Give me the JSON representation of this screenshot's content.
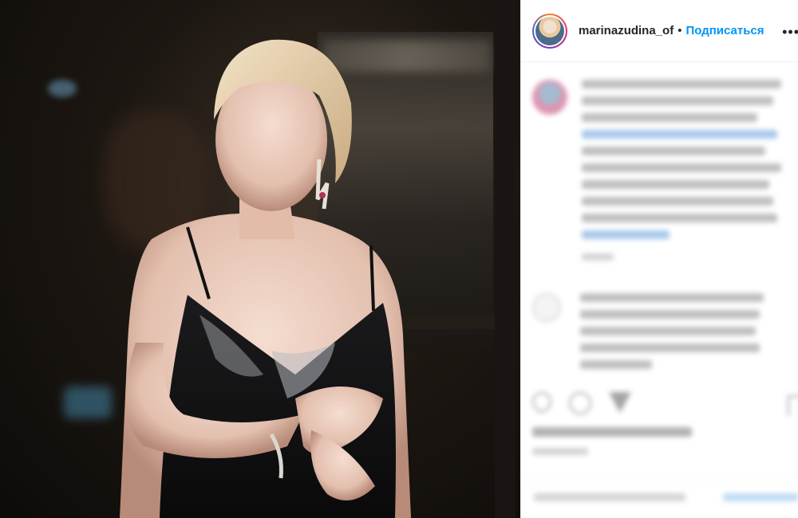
{
  "header": {
    "username": "marinazudina_of",
    "separator": "•",
    "follow_label": "Подписаться",
    "more_label": "•••"
  },
  "colors": {
    "follow_blue": "#0095f6",
    "text_dark": "#262626",
    "divider": "#efefef"
  },
  "icons": [
    "heart-icon",
    "comment-icon",
    "share-icon",
    "bookmark-icon",
    "more-icon"
  ]
}
